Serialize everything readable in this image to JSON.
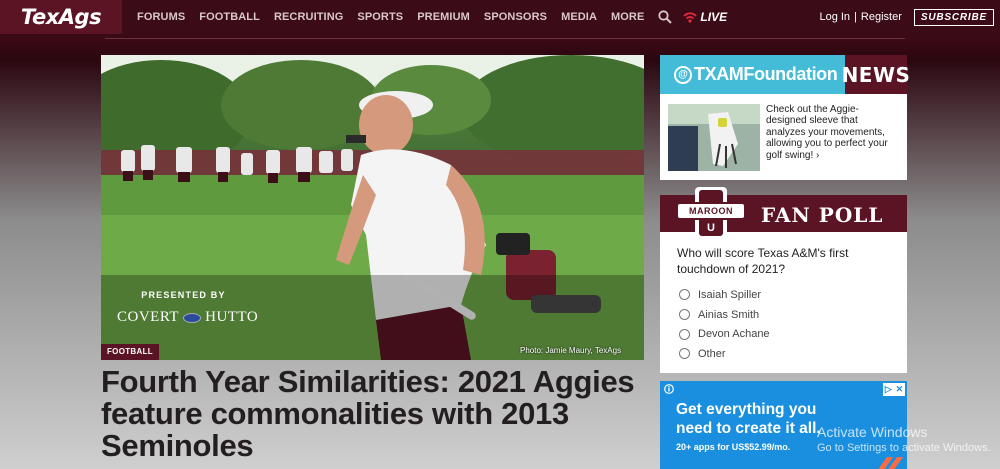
{
  "brand": {
    "logo": "TexAgs"
  },
  "nav": {
    "items": [
      "FORUMS",
      "FOOTBALL",
      "RECRUITING",
      "SPORTS",
      "PREMIUM",
      "SPONSORS",
      "MEDIA",
      "MORE"
    ],
    "live_label": "LIVE",
    "login_label": "Log In",
    "separator": "|",
    "register_label": "Register",
    "subscribe_label": "SUBSCRIBE"
  },
  "hero": {
    "presented_by": "PRESENTED BY",
    "sponsor_left": "COVERT",
    "sponsor_right": "HUTTO",
    "category": "FOOTBALL",
    "photo_credit": "Photo: Jamie Maury, TexAgs",
    "headline": "Fourth Year Similarities: 2021 Aggies feature commonalities with 2013 Seminoles"
  },
  "news_card": {
    "at": "@",
    "handle": "TXAMFoundation",
    "tag": "NEWS",
    "blurb": "Check out the Aggie-designed sleeve that analyzes your movements, allowing you to perfect your golf swing! ›"
  },
  "poll": {
    "badge_text": "MAROON",
    "badge_letter": "U",
    "title": "FAN POLL",
    "question": "Who will score Texas A&M's first touchdown of 2021?",
    "options": [
      "Isaiah Spiller",
      "Ainias Smith",
      "Devon Achane",
      "Other"
    ]
  },
  "ad": {
    "headline_line1": "Get everything you",
    "headline_line2": "need to create it all.",
    "sub": "20+ apps for US$52.99/mo.",
    "close_left": "▷",
    "close_right": "✕"
  },
  "watermark": {
    "line1": "Activate Windows",
    "line2": "Go to Settings to activate Windows."
  },
  "colors": {
    "maroon": "#5a1424",
    "nav_bg": "#3b0b17",
    "news_blue": "#44bcd8",
    "ad_blue": "#1a8fe0"
  }
}
